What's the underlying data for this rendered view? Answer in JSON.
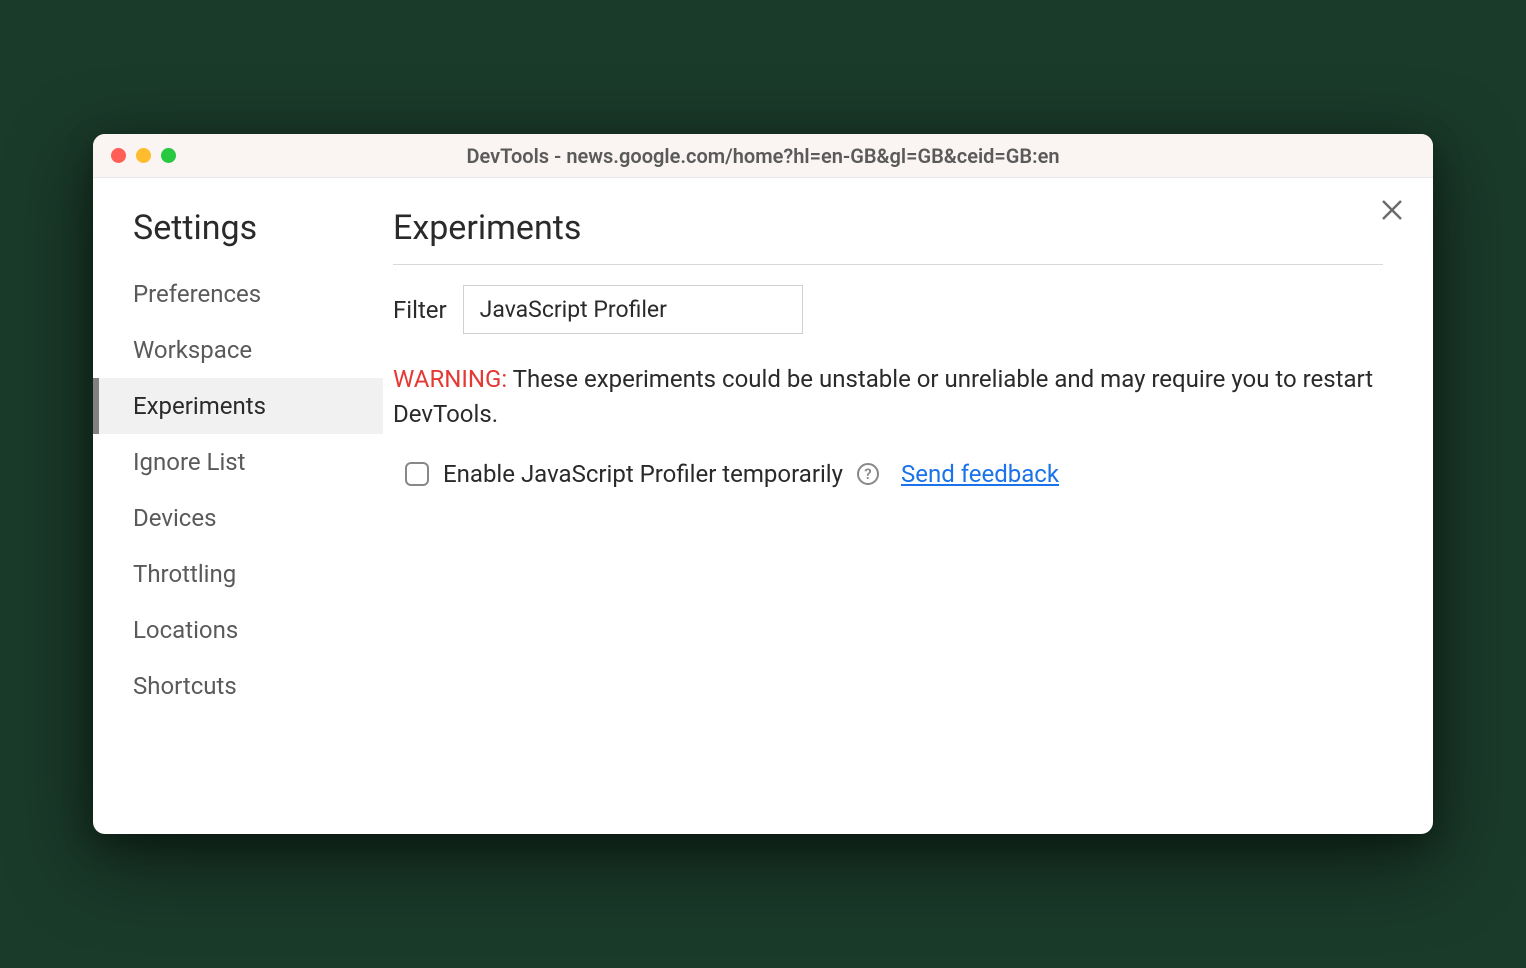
{
  "window": {
    "title": "DevTools - news.google.com/home?hl=en-GB&gl=GB&ceid=GB:en"
  },
  "sidebar": {
    "title": "Settings",
    "items": [
      {
        "label": "Preferences",
        "active": false
      },
      {
        "label": "Workspace",
        "active": false
      },
      {
        "label": "Experiments",
        "active": true
      },
      {
        "label": "Ignore List",
        "active": false
      },
      {
        "label": "Devices",
        "active": false
      },
      {
        "label": "Throttling",
        "active": false
      },
      {
        "label": "Locations",
        "active": false
      },
      {
        "label": "Shortcuts",
        "active": false
      }
    ]
  },
  "main": {
    "title": "Experiments",
    "filter": {
      "label": "Filter",
      "value": "JavaScript Profiler"
    },
    "warning": {
      "prefix": "WARNING:",
      "text": " These experiments could be unstable or unreliable and may require you to restart DevTools."
    },
    "experiment": {
      "label": "Enable JavaScript Profiler temporarily",
      "checked": false,
      "help_symbol": "?",
      "feedback_link": "Send feedback"
    }
  }
}
